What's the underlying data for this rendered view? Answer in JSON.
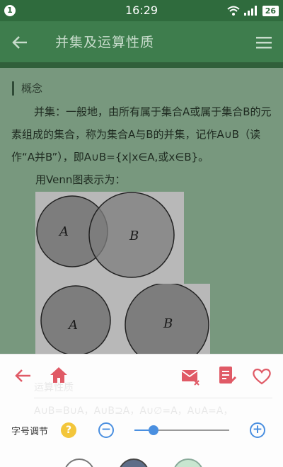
{
  "status_bar": {
    "notification_count": "1",
    "time": "16:29",
    "battery": "26"
  },
  "app_bar": {
    "title": "并集及运算性质",
    "back_icon": "arrow-left-icon",
    "menu_icon": "hamburger-menu-icon"
  },
  "content": {
    "section_title": "概念",
    "paragraph1": "并集：一般地，由所有属于集合A或属于集合B的元素组成的集合，称为集合A与B的并集，记作A∪B（读作“A并B”），即A∪B={x|x∈A,或x∈B}。",
    "paragraph2": "用Venn图表示为：",
    "venn_labels": [
      "A",
      "B",
      "A",
      "B"
    ]
  },
  "bottom_panel": {
    "icons": [
      "back-arrow-icon",
      "home-icon",
      "mail-icon",
      "notes-icon",
      "heart-icon"
    ],
    "ghost_text1": "运算性质",
    "ghost_text2": "A∪B=B∪A，A∪B⊇A，A∪∅=A，A∪A=A，",
    "font_size_label": "字号调节",
    "help_glyph": "?",
    "minus_glyph": "−",
    "plus_glyph": "+",
    "font_slider_value": 0.2,
    "theme_colors": [
      "#ffffff",
      "#5e6e88",
      "#c8e6d0"
    ],
    "accent_color": "#e05a66",
    "slider_color": "#4a8fe0"
  }
}
